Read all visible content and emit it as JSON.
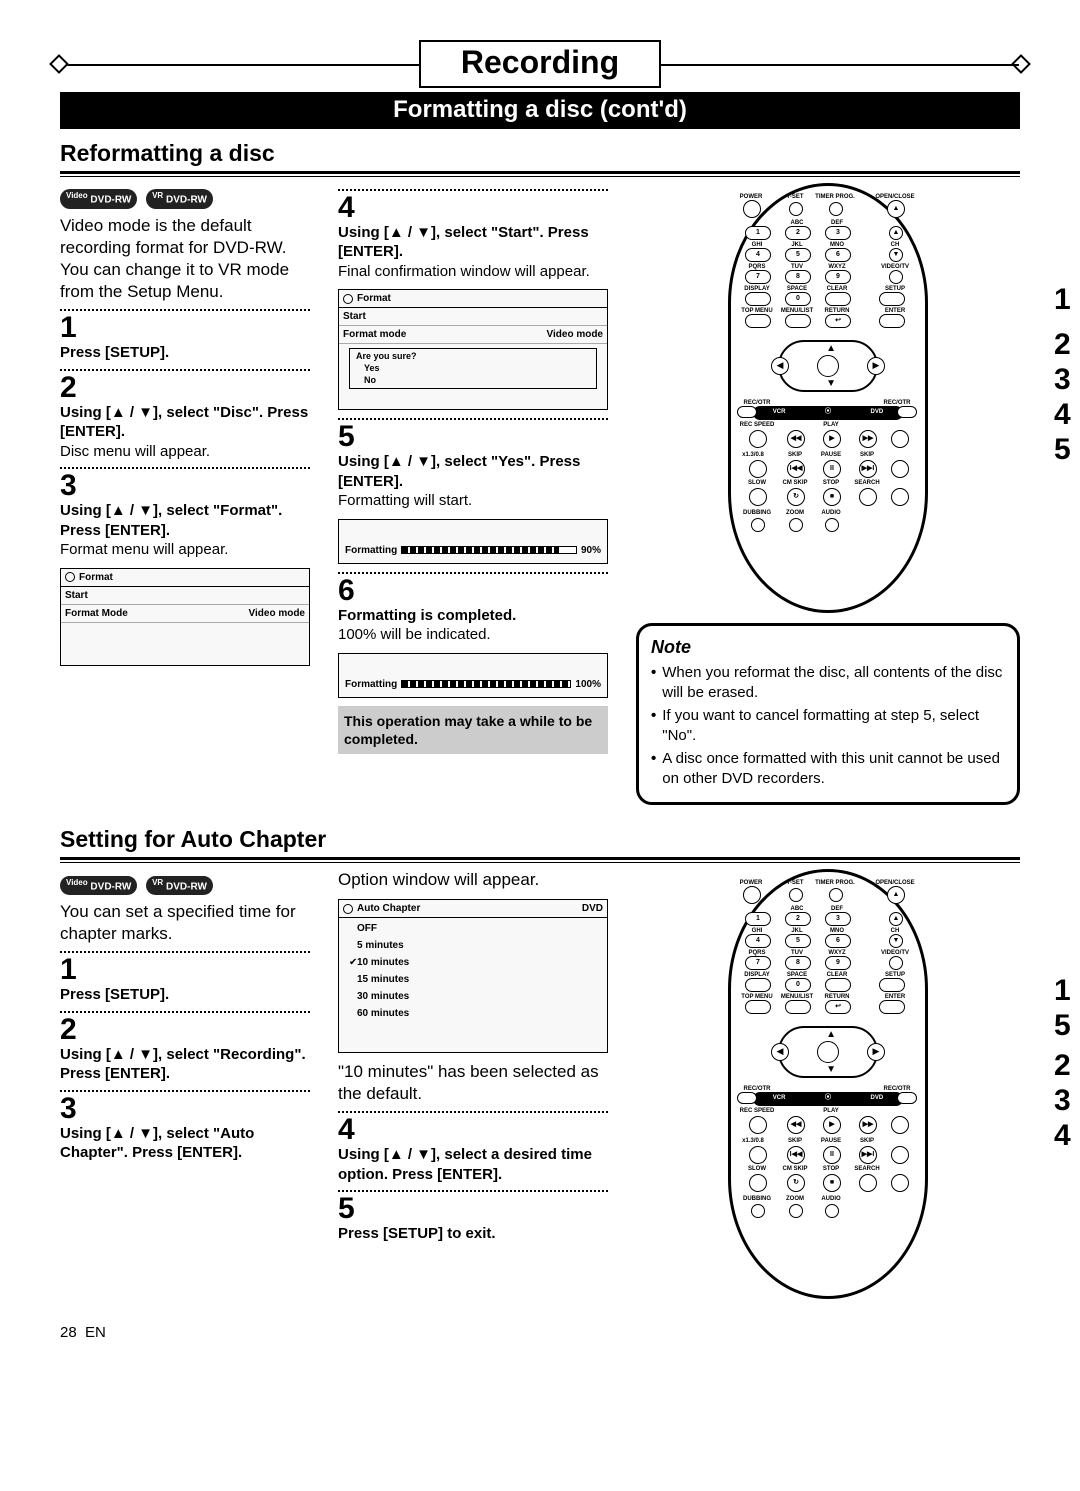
{
  "header": {
    "title": "Recording",
    "subtitle": "Formatting a disc (cont'd)"
  },
  "sectionA": {
    "heading": "Reformatting a disc",
    "badge1": "DVD-RW",
    "badge1_sup": "Video",
    "badge2": "DVD-RW",
    "badge2_sup": "VR",
    "intro": "Video mode is the default recording format for DVD-RW. You can change it to VR mode from the Setup Menu.",
    "step1": {
      "num": "1",
      "inst": "Press [SETUP]."
    },
    "step2": {
      "num": "2",
      "inst": "Using [▲ / ▼], select \"Disc\". Press [ENTER].",
      "desc": "Disc menu will appear."
    },
    "step3": {
      "num": "3",
      "inst": "Using [▲ / ▼], select \"Format\". Press [ENTER].",
      "desc": "Format menu will appear.",
      "osd": {
        "title": "Format",
        "row1": "Start",
        "row2_l": "Format Mode",
        "row2_r": "Video mode"
      }
    },
    "step4": {
      "num": "4",
      "inst": "Using [▲ / ▼], select \"Start\". Press [ENTER].",
      "desc": "Final confirmation window will appear.",
      "osd": {
        "title": "Format",
        "row1": "Start",
        "row2_l": "Format mode",
        "row2_r": "Video mode",
        "prompt": "Are you sure?",
        "opt1": "Yes",
        "opt2": "No"
      }
    },
    "step5": {
      "num": "5",
      "inst": "Using [▲ / ▼], select \"Yes\". Press [ENTER].",
      "desc": "Formatting will start.",
      "osd": {
        "label": "Formatting",
        "pct": "90%"
      }
    },
    "step6": {
      "num": "6",
      "inst": "Formatting is completed.",
      "desc": "100% will be indicated.",
      "osd": {
        "label": "Formatting",
        "pct": "100%"
      }
    },
    "warn": "This operation may take a while to be completed.",
    "note": {
      "title": "Note",
      "i1": "When you reformat the disc, all contents of the disc will be erased.",
      "i2": "If you want to cancel formatting at step 5, select \"No\".",
      "i3": "A disc once formatted with this unit cannot be used on other DVD recorders."
    }
  },
  "sectionB": {
    "heading": "Setting for Auto Chapter",
    "badge1": "DVD-RW",
    "badge1_sup": "Video",
    "badge2": "DVD-RW",
    "badge2_sup": "VR",
    "intro": "You can set a specified time for chapter marks.",
    "step1": {
      "num": "1",
      "inst": "Press [SETUP]."
    },
    "step2": {
      "num": "2",
      "inst": "Using [▲ / ▼], select \"Recording\". Press [ENTER]."
    },
    "step3": {
      "num": "3",
      "inst": "Using [▲ / ▼], select \"Auto Chapter\". Press [ENTER]."
    },
    "mid": {
      "lead": "Option window will appear.",
      "osd": {
        "title": "Auto Chapter",
        "tag": "DVD",
        "opts": [
          "OFF",
          "5 minutes",
          "10 minutes",
          "15 minutes",
          "30 minutes",
          "60 minutes"
        ],
        "selected_index": 2
      },
      "desc": "\"10 minutes\" has been selected as the default."
    },
    "step4": {
      "num": "4",
      "inst": "Using [▲ / ▼], select a desired time option. Press [ENTER]."
    },
    "step5": {
      "num": "5",
      "inst": "Press [SETUP] to exit."
    }
  },
  "remote": {
    "labels": {
      "power": "POWER",
      "tset": "T-SET",
      "timer": "TIMER PROG.",
      "open": "OPEN/CLOSE",
      "abc": "ABC",
      "def": "DEF",
      "ghi": "GHI",
      "jkl": "JKL",
      "mno": "MNO",
      "ch": "CH",
      "pqrs": "PQRS",
      "tuv": "TUV",
      "wxyz": "WXYZ",
      "videotv": "VIDEO/TV",
      "display": "DISPLAY",
      "space": "SPACE",
      "clear": "CLEAR",
      "setup": "SETUP",
      "topmenu": "TOP MENU",
      "menulist": "MENU/LIST",
      "return": "RETURN",
      "enter": "ENTER",
      "recotr": "REC/OTR",
      "vcr": "VCR",
      "dvd": "DVD",
      "recspeed": "REC SPEED",
      "play": "PLAY",
      "slow": "SLOW",
      "cmskip": "CM SKIP",
      "stop": "STOP",
      "search": "SEARCH",
      "skip": "SKIP",
      "pause": "PAUSE",
      "x13": "x1.3/0.8",
      "dubbing": "DUBBING",
      "zoom": "ZOOM",
      "audio": "AUDIO"
    },
    "nums": {
      "n1": "1",
      "n2": "2",
      "n3": "3",
      "n4": "4",
      "n5": "5",
      "n6": "6",
      "n7": "7",
      "n8": "8",
      "n9": "9",
      "n0": "0"
    }
  },
  "calloutsA": {
    "c1": "1",
    "c2": "2",
    "c3": "3",
    "c4": "4",
    "c5": "5"
  },
  "calloutsB": {
    "c1": "1",
    "c2": "5",
    "c3": "2",
    "c4": "3",
    "c5": "4"
  },
  "footer": {
    "page": "28",
    "lang": "EN"
  }
}
